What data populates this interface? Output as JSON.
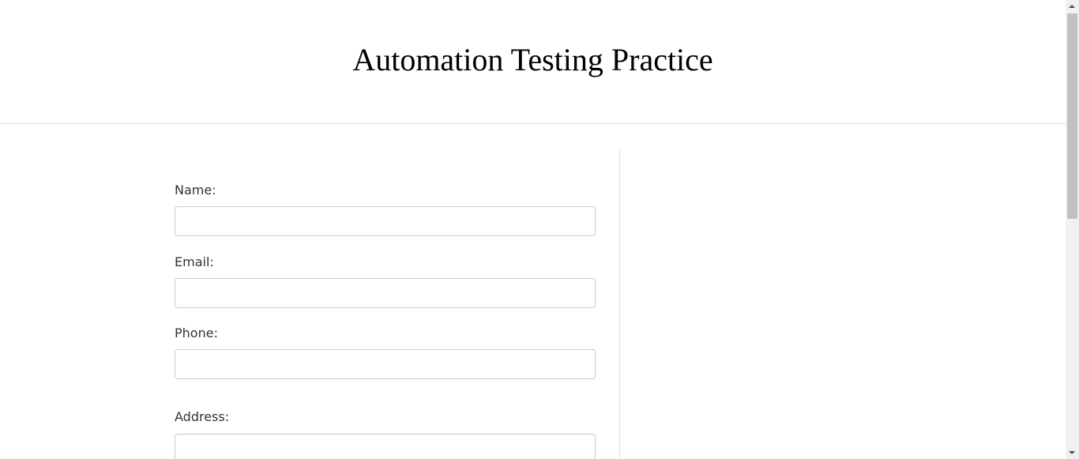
{
  "header": {
    "title": "Automation Testing Practice"
  },
  "form": {
    "name_label": "Name:",
    "name_value": "",
    "email_label": "Email:",
    "email_value": "",
    "phone_label": "Phone:",
    "phone_value": "",
    "address_label": "Address:",
    "address_value": ""
  },
  "scrollbar": {
    "position": 0
  }
}
